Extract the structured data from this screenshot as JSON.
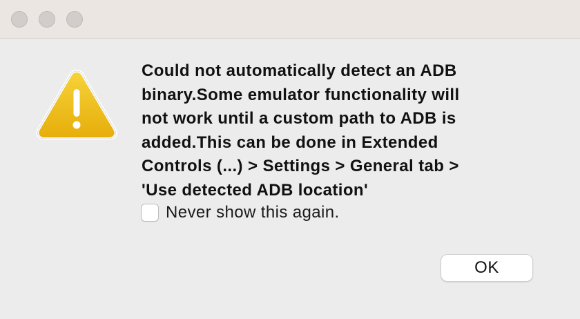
{
  "dialog": {
    "icon": "warning-icon",
    "message": "Could not automatically detect an ADB\nbinary.Some emulator functionality will\nnot work until a custom path to ADB  is\nadded.This can be done in Extended\nControls (...) > Settings > General tab >\n'Use detected ADB location'",
    "checkbox_label": "Never show this again.",
    "checkbox_checked": false,
    "ok_label": "OK"
  },
  "colors": {
    "warning_yellow": "#f2c21b",
    "warning_border": "#ffffff"
  }
}
